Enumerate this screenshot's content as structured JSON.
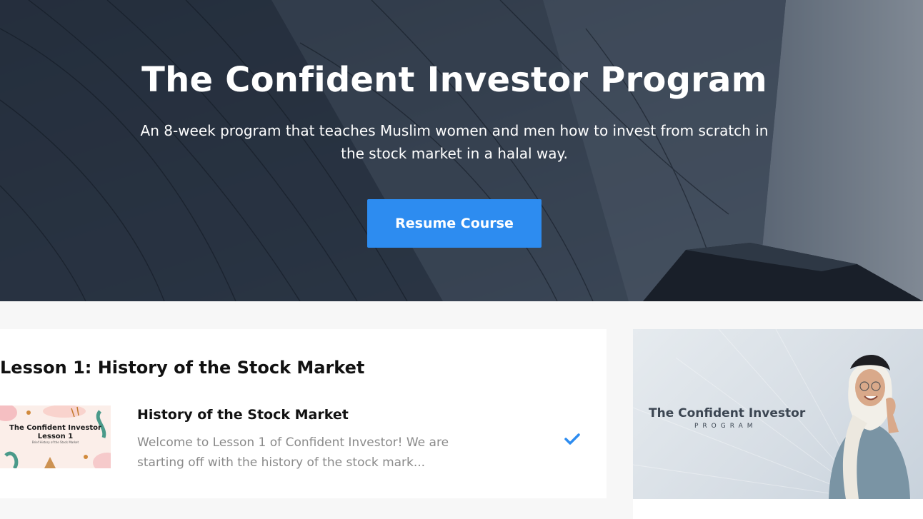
{
  "hero": {
    "title": "The Confident Investor Program",
    "subtitle": "An 8-week program that teaches Muslim women and men how to invest from scratch in the stock market in a halal way.",
    "resume_button": "Resume Course"
  },
  "lesson_section": {
    "heading": "Lesson 1: History of the Stock Market",
    "items": [
      {
        "title": "History of the Stock Market",
        "description": "Welcome to Lesson 1 of Confident Investor! We are starting off with the history of the stock mark...",
        "thumbnail_title": "The Confident Investor",
        "thumbnail_lesson": "Lesson 1",
        "thumbnail_sub": "Brief History of the Stock Market",
        "completed": true,
        "status_icon": "check-icon"
      }
    ]
  },
  "promo": {
    "title": "The Confident Investor",
    "subtitle": "PROGRAM"
  },
  "colors": {
    "accent": "#2d8cf0",
    "heading_text": "#111111",
    "muted_text": "#8a8a8a",
    "page_bg": "#f7f7f7"
  }
}
